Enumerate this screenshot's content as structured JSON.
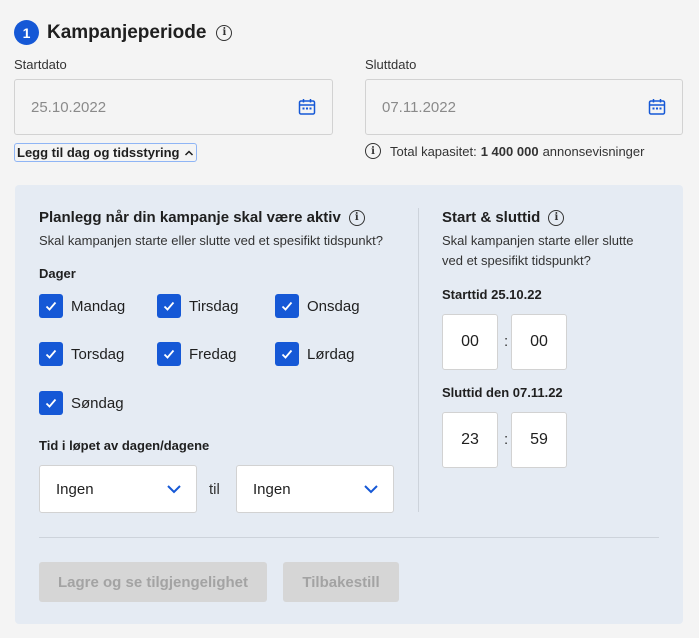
{
  "header": {
    "step_number": "1",
    "title": "Kampanjeperiode"
  },
  "dates": {
    "start_label": "Startdato",
    "start_value": "25.10.2022",
    "end_label": "Sluttdato",
    "end_value": "07.11.2022"
  },
  "toggle_link": "Legg til dag og tidsstyring",
  "capacity": {
    "label": "Total kapasitet:",
    "value": "1 400 000",
    "unit": "annonsevisninger"
  },
  "schedule": {
    "title": "Planlegg når din kampanje skal være aktiv",
    "description": "Skal kampanjen starte eller slutte ved et spesifikt tidspunkt?",
    "days_label": "Dager",
    "days": [
      {
        "label": "Mandag",
        "checked": true
      },
      {
        "label": "Tirsdag",
        "checked": true
      },
      {
        "label": "Onsdag",
        "checked": true
      },
      {
        "label": "Torsdag",
        "checked": true
      },
      {
        "label": "Fredag",
        "checked": true
      },
      {
        "label": "Lørdag",
        "checked": true
      },
      {
        "label": "Søndag",
        "checked": true
      }
    ],
    "time_label": "Tid i løpet av dagen/dagene",
    "from_value": "Ingen",
    "to_word": "til",
    "to_value": "Ingen"
  },
  "start_end": {
    "title": "Start & sluttid",
    "description_line1": "Skal kampanjen starte eller slutte",
    "description_line2": "ved et spesifikt tidspunkt?",
    "start_label": "Starttid 25.10.22",
    "start_hour": "00",
    "start_minute": "00",
    "end_label": "Sluttid den 07.11.22",
    "end_hour": "23",
    "end_minute": "59",
    "separator": ":"
  },
  "actions": {
    "save_label": "Lagre og se tilgjengelighet",
    "reset_label": "Tilbakestill"
  },
  "colors": {
    "accent": "#1558d6",
    "panel": "#e5ebf3",
    "disabled": "#d6d6d6"
  }
}
